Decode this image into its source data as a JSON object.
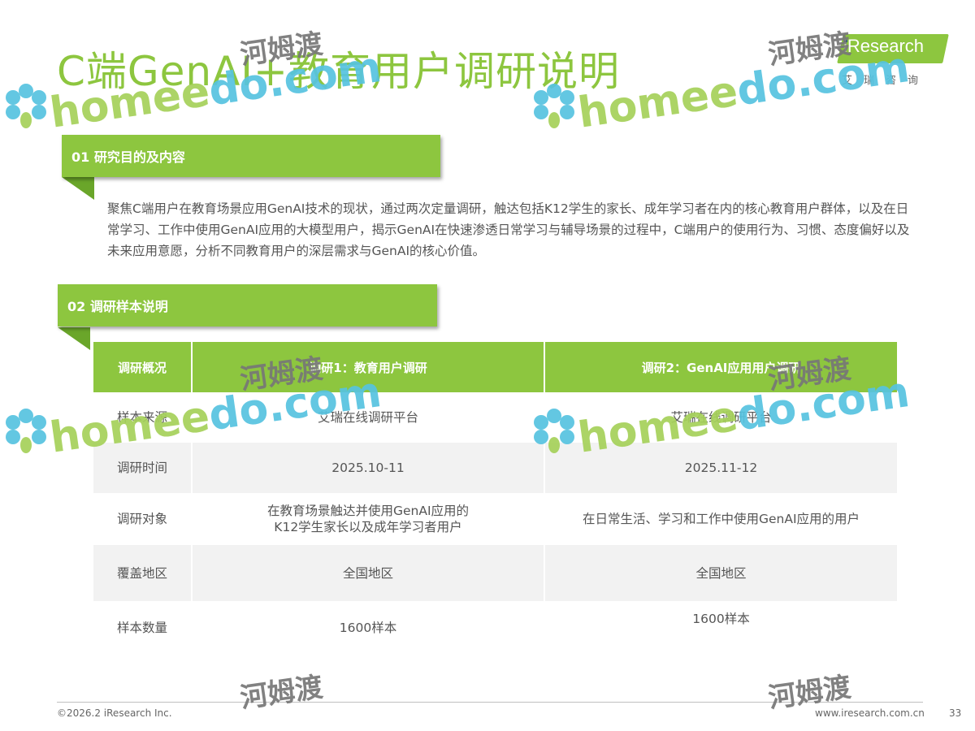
{
  "header": {
    "title": "C端GenAI+教育用户调研说明",
    "logo_text": "iResearch",
    "logo_sub": "艾瑞咨询"
  },
  "section1": {
    "tab_label": "01 研究目的及内容",
    "body": "聚焦C端用户在教育场景应用GenAI技术的现状，通过两次定量调研，触达包括K12学生的家长、成年学习者在内的核心教育用户群体，以及在日常学习、工作中使用GenAI应用的大模型用户，揭示GenAI在快速渗透日常学习与辅导场景的过程中，C端用户的使用行为、习惯、态度偏好以及未来应用意愿，分析不同教育用户的深层需求与GenAI的核心价值。"
  },
  "section2": {
    "tab_label": "02 调研样本说明"
  },
  "table": {
    "headers": [
      "调研概况",
      "调研1：教育用户调研",
      "调研2：GenAI应用用户调研"
    ],
    "rows": [
      {
        "label": "样本来源",
        "c1": "艾瑞在线调研平台",
        "c2": "艾瑞在线调研平台"
      },
      {
        "label": "调研时间",
        "c1": "2025.10-11",
        "c2": "2025.11-12"
      },
      {
        "label": "调研对象",
        "c1": "在教育场景触达并使用GenAI应用的",
        "c1b": "K12学生家长以及成年学习者用户",
        "c2": "在日常生活、学习和工作中使用GenAI应用的用户"
      },
      {
        "label": "覆盖地区",
        "c1": "全国地区",
        "c2": "全国地区"
      },
      {
        "label": "样本数量",
        "c1": "1600样本",
        "c2": "1600样本"
      }
    ]
  },
  "footer": {
    "copyright": "©2026.2 iResearch Inc.",
    "url": "www.iresearch.com.cn",
    "page": "33"
  },
  "watermark": {
    "brand_a": "home",
    "brand_b": "do.com",
    "brand_mid": "e",
    "cn": "河姆渡"
  },
  "colors": {
    "accent": "#8DC63F",
    "watermark_green": "#a6d15a",
    "watermark_blue": "#56c3e0"
  }
}
